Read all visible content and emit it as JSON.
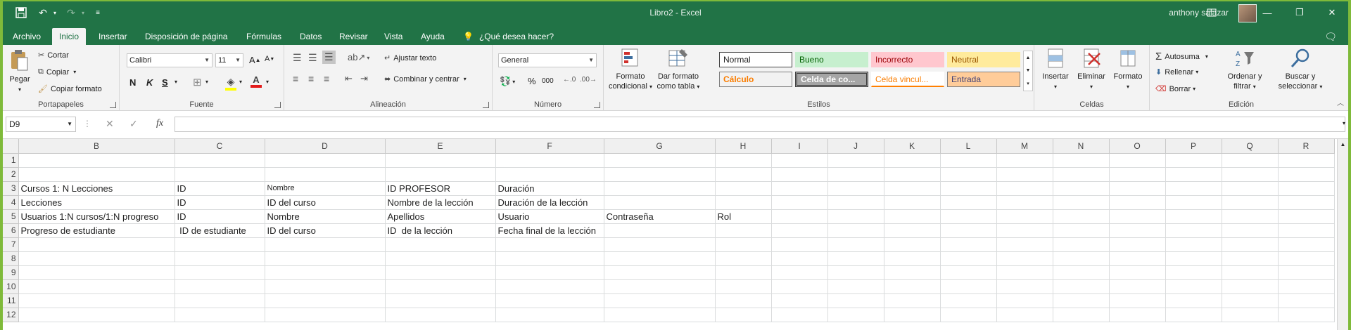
{
  "window": {
    "title": "Libro2  -  Excel",
    "user": "anthony salazar"
  },
  "tabs": [
    "Archivo",
    "Inicio",
    "Insertar",
    "Disposición de página",
    "Fórmulas",
    "Datos",
    "Revisar",
    "Vista",
    "Ayuda"
  ],
  "tell_me": "¿Qué desea hacer?",
  "clipboard": {
    "paste": "Pegar",
    "cut": "Cortar",
    "copy": "Copiar",
    "format_painter": "Copiar formato",
    "label": "Portapapeles"
  },
  "font": {
    "name": "Calibri",
    "size": "11",
    "bold": "N",
    "italic": "K",
    "underline": "S",
    "label": "Fuente"
  },
  "alignment": {
    "wrap": "Ajustar texto",
    "merge": "Combinar y centrar",
    "label": "Alineación"
  },
  "number": {
    "format": "General",
    "percent": "%",
    "thousands": "000",
    "label": "Número"
  },
  "styles": {
    "cond_format": "Formato condicional",
    "table_format": "Dar formato como tabla",
    "cells": [
      "Normal",
      "Bueno",
      "Incorrecto",
      "Neutral",
      "Cálculo",
      "Celda de co...",
      "Celda vincul...",
      "Entrada"
    ],
    "label": "Estilos"
  },
  "cells_group": {
    "insert": "Insertar",
    "delete": "Eliminar",
    "format": "Formato",
    "label": "Celdas"
  },
  "editing": {
    "autosum": "Autosuma",
    "fill": "Rellenar",
    "clear": "Borrar",
    "sort": "Ordenar y filtrar",
    "find": "Buscar y seleccionar",
    "label": "Edición"
  },
  "formula_bar": {
    "name_box": "D9",
    "fx": "fx",
    "content": ""
  },
  "sheet": {
    "columns": [
      "B",
      "C",
      "D",
      "E",
      "F",
      "G",
      "H",
      "I",
      "J",
      "K",
      "L",
      "M",
      "N",
      "O",
      "P",
      "Q",
      "R"
    ],
    "rows": [
      {
        "n": "1",
        "cells": [
          "",
          "",
          "",
          "",
          "",
          "",
          "",
          ""
        ]
      },
      {
        "n": "2",
        "cells": [
          "",
          "",
          "",
          "",
          "",
          "",
          "",
          ""
        ]
      },
      {
        "n": "3",
        "cells": [
          "Cursos  1: N Lecciones",
          "ID",
          "Nombre",
          "ID PROFESOR",
          "Duración",
          "",
          ""
        ]
      },
      {
        "n": "4",
        "cells": [
          "Lecciones",
          "ID",
          "ID del curso",
          "Nombre de la lección",
          "Duración de la lección",
          "",
          ""
        ]
      },
      {
        "n": "5",
        "cells": [
          "Usuarios  1:N cursos/1:N progreso",
          "ID",
          "Nombre",
          "Apellidos",
          "Usuario",
          "Contraseña",
          "Rol"
        ]
      },
      {
        "n": "6",
        "cells": [
          "Progreso de estudiante",
          " ID de estudiante",
          "ID del curso",
          "ID  de la lección",
          "Fecha final de la lección",
          "",
          ""
        ]
      },
      {
        "n": "7",
        "cells": []
      },
      {
        "n": "8",
        "cells": []
      },
      {
        "n": "9",
        "cells": []
      },
      {
        "n": "10",
        "cells": []
      },
      {
        "n": "11",
        "cells": []
      },
      {
        "n": "12",
        "cells": []
      }
    ]
  }
}
